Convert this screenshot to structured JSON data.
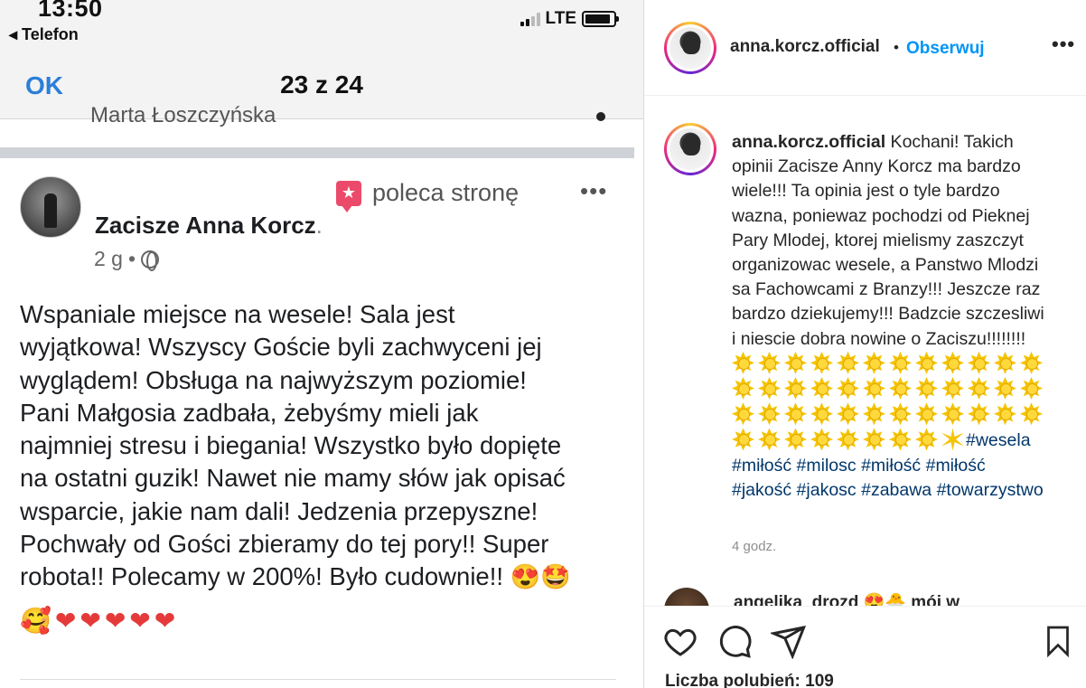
{
  "phone": {
    "status_time": "13:50",
    "back_label": "◂ Telefon",
    "network": "LTE",
    "battery_level": 0.9,
    "ok_label": "OK",
    "pager": "23 z 24",
    "cut_text": "Marta Łoszczyńska"
  },
  "fb_post": {
    "recommends_label": "poleca stronę",
    "more_label": "•••",
    "page_name": "Zacisze Anna Korcz",
    "page_name_suffix": ".",
    "time": "2 g",
    "meta_sep": "•",
    "body": "Wspaniale miejsce na wesele! Sala jest\nwyjątkowa! Wszyscy Goście byli zachwyceni jej\nwyglądem! Obsługa na najwyższym poziomie!\nPani Małgosia zadbała, żebyśmy mieli jak\nnajmniej stresu i biegania! Wszystko było dopięte\nna ostatni guzik! Nawet nie mamy słów jak opisać\nwsparcie, jakie nam dali! Jedzenia przepyszne!\nPochwały od Gości zbieramy do tej pory!! Super\nrobota!! Polecamy w 200%! Było cudownie!!",
    "trailing_emoji": "😍🤩",
    "hearts_lead": "🥰",
    "hearts": [
      "❤",
      "❤",
      "❤",
      "❤",
      "❤"
    ]
  },
  "instagram": {
    "username": "anna.korcz.official",
    "dot": "•",
    "follow_label": "Obserwuj",
    "more_label": "•••",
    "caption_user": "anna.korcz.official",
    "caption_text": " Kochani! Takich opinii Zacisze Anny Korcz ma bardzo wiele!!! Ta opinia jest o tyle bardzo wazna, poniewaz pochodzi od Pieknej Pary Mlodej, ktorej mielismy zaszczyt organizowac wesele, a Panstwo Mlodzi sa Fachowcami z Branzy!!! Jeszcze raz bardzo dziekujemy!!! Badzcie szczesliwi i niescie dobra nowine o Zaciszu!!!!!!!!",
    "sun_count": 44,
    "hashtags": [
      "#wesela",
      "#miłość",
      "#milosc",
      "#miłość",
      "#miłość",
      "#jakość",
      "#jakosc",
      "#zabawa",
      "#towarzystwo"
    ],
    "time": "4 godz.",
    "comment_preview": "angelika_drozd 😍🐣 mój w",
    "likes": "Liczba polubień: 109",
    "icons": [
      "heart-icon",
      "comment-icon",
      "share-icon",
      "bookmark-icon"
    ]
  },
  "colors": {
    "ig_blue": "#0095f6",
    "ios_blue": "#2b7fd8",
    "fb_text": "#1c1e21",
    "recommend_red": "#ec4a6a"
  }
}
